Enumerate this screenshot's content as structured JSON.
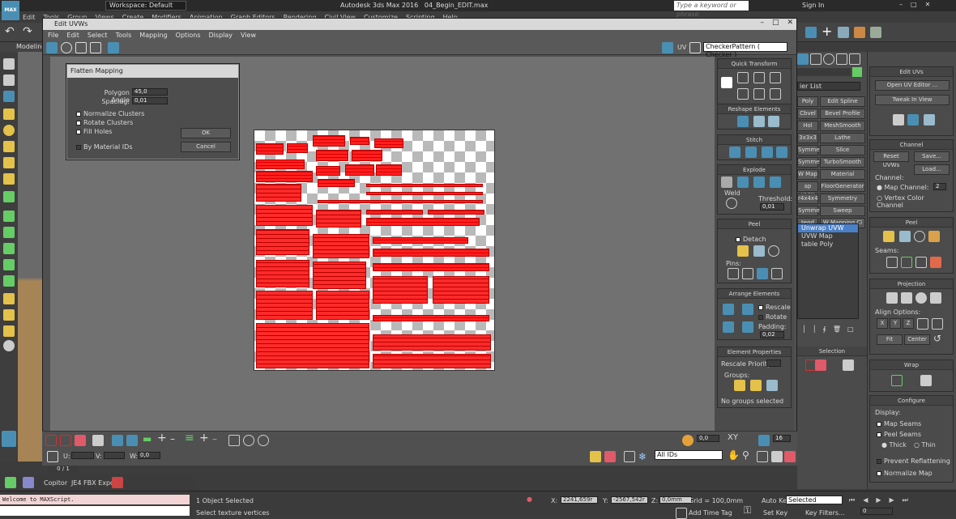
{
  "app": {
    "title": "Autodesk 3ds Max 2016",
    "file": "04_Begin_EDIT.max",
    "workspace": "Workspace: Default",
    "search_placeholder": "Type a keyword or phrase",
    "sign_in": "Sign In",
    "logo": "MAX"
  },
  "main_menu": [
    "Edit",
    "Tools",
    "Group",
    "Views",
    "Create",
    "Modifiers",
    "Animation",
    "Graph Editors",
    "Rendering",
    "Civil View",
    "Customize",
    "Scripting",
    "Help"
  ],
  "viewport_label": "Modeling",
  "uv_editor": {
    "title": "Edit UVWs",
    "menu": [
      "File",
      "Edit",
      "Select",
      "Tools",
      "Mapping",
      "Options",
      "Display",
      "View"
    ],
    "uv_label": "UV",
    "texture": "CheckerPattern  ( Checker )",
    "flatten": {
      "title": "Flatten Mapping",
      "polygon_angle_label": "Polygon Angle",
      "polygon_angle": "45,0",
      "spacing_label": "Spacing:",
      "spacing": "0,01",
      "normalize": "Normalize Clusters",
      "rotate": "Rotate Clusters",
      "fill": "Fill Holes",
      "bymat": "By Material IDs",
      "ok": "OK",
      "cancel": "Cancel"
    },
    "bottom": {
      "all_ids": "All IDs",
      "u_label": "U:",
      "v_label": "V:",
      "w_label": "W:",
      "w_value": "0,0",
      "xy": "XY",
      "spin_val": "0,0",
      "sixteen": "16",
      "ratio": "0 / 1"
    },
    "sections": {
      "quick": "Quick Transform",
      "reshape": "Reshape Elements",
      "stitch": "Stitch",
      "explode": "Explode",
      "weld": "Weld",
      "threshold_label": "Threshold:",
      "threshold": "0,01",
      "peel": "Peel",
      "detach": "Detach",
      "pins": "Pins:",
      "arrange": "Arrange Elements",
      "rescale": "Rescale",
      "rotate": "Rotate",
      "padding_label": "Padding:",
      "padding": "0,02",
      "elemprops": "Element Properties",
      "rescale_priority": "Rescale Priority:",
      "groups": "Groups:",
      "no_groups": "No groups selected"
    }
  },
  "modifier_list": {
    "label": "ier List",
    "buttons": [
      "Poly",
      "Edit Spline",
      "Cbvel",
      "Bevel Profile",
      "Hol",
      "MeshSmooth",
      "3x3x3",
      "Lathe",
      "Symmetry",
      "Slice",
      "Symmetry",
      "TurboSmooth",
      "W Map",
      "Material",
      "ap UVW",
      "FloorGenerator",
      "r4x4x4",
      "Symmetry",
      "Symmetry",
      "Sweep",
      "tend",
      "W Mapping Cl"
    ],
    "stack": [
      "Unwrap UVW",
      "UVW Map",
      "table Poly"
    ],
    "selection": "Selection"
  },
  "right_panel": {
    "edit_uvs": "Edit UVs",
    "open_uv": "Open UV Editor ...",
    "tweak": "Tweak In View",
    "channel": "Channel",
    "reset": "Reset UVWs",
    "save": "Save...",
    "load": "Load...",
    "channel_label": "Channel:",
    "map_channel": "Map Channel:",
    "map_channel_value": "2",
    "vertex_color": "Vertex Color Channel",
    "peel": "Peel",
    "seams": "Seams:",
    "projection": "Projection",
    "align": "Align Options:",
    "axes": [
      "X",
      "Y",
      "Z"
    ],
    "fit": "Fit",
    "center": "Center",
    "wrap": "Wrap",
    "configure": "Configure",
    "display": "Display:",
    "map_seams": "Map Seams",
    "peel_seams": "Peel Seams",
    "thick": "Thick",
    "thin": "Thin",
    "prevent": "Prevent Reflattening",
    "normalize": "Normalize Map"
  },
  "status": {
    "listener": "Welcome to MAXScript.",
    "selected": "1 Object Selected",
    "prompt": "Select texture vertices",
    "x_label": "X:",
    "x": "2241,659r",
    "y_label": "Y:",
    "y": "-2567,542r",
    "z_label": "Z:",
    "z": "0,0mm",
    "grid": "Grid = 100,0mm",
    "autokey": "Auto Key",
    "selected_dd": "Selected",
    "setkey": "Set Key",
    "keyfilters": "Key Filters...",
    "addtimetag": "Add Time Tag",
    "frame": "0",
    "copitor": "Copitor",
    "fbx": "JE4 FBX Expor"
  },
  "colors": {
    "accent": "#4a8fb3",
    "uv": "#ff1e1e",
    "checker": "#b9b9b9"
  }
}
